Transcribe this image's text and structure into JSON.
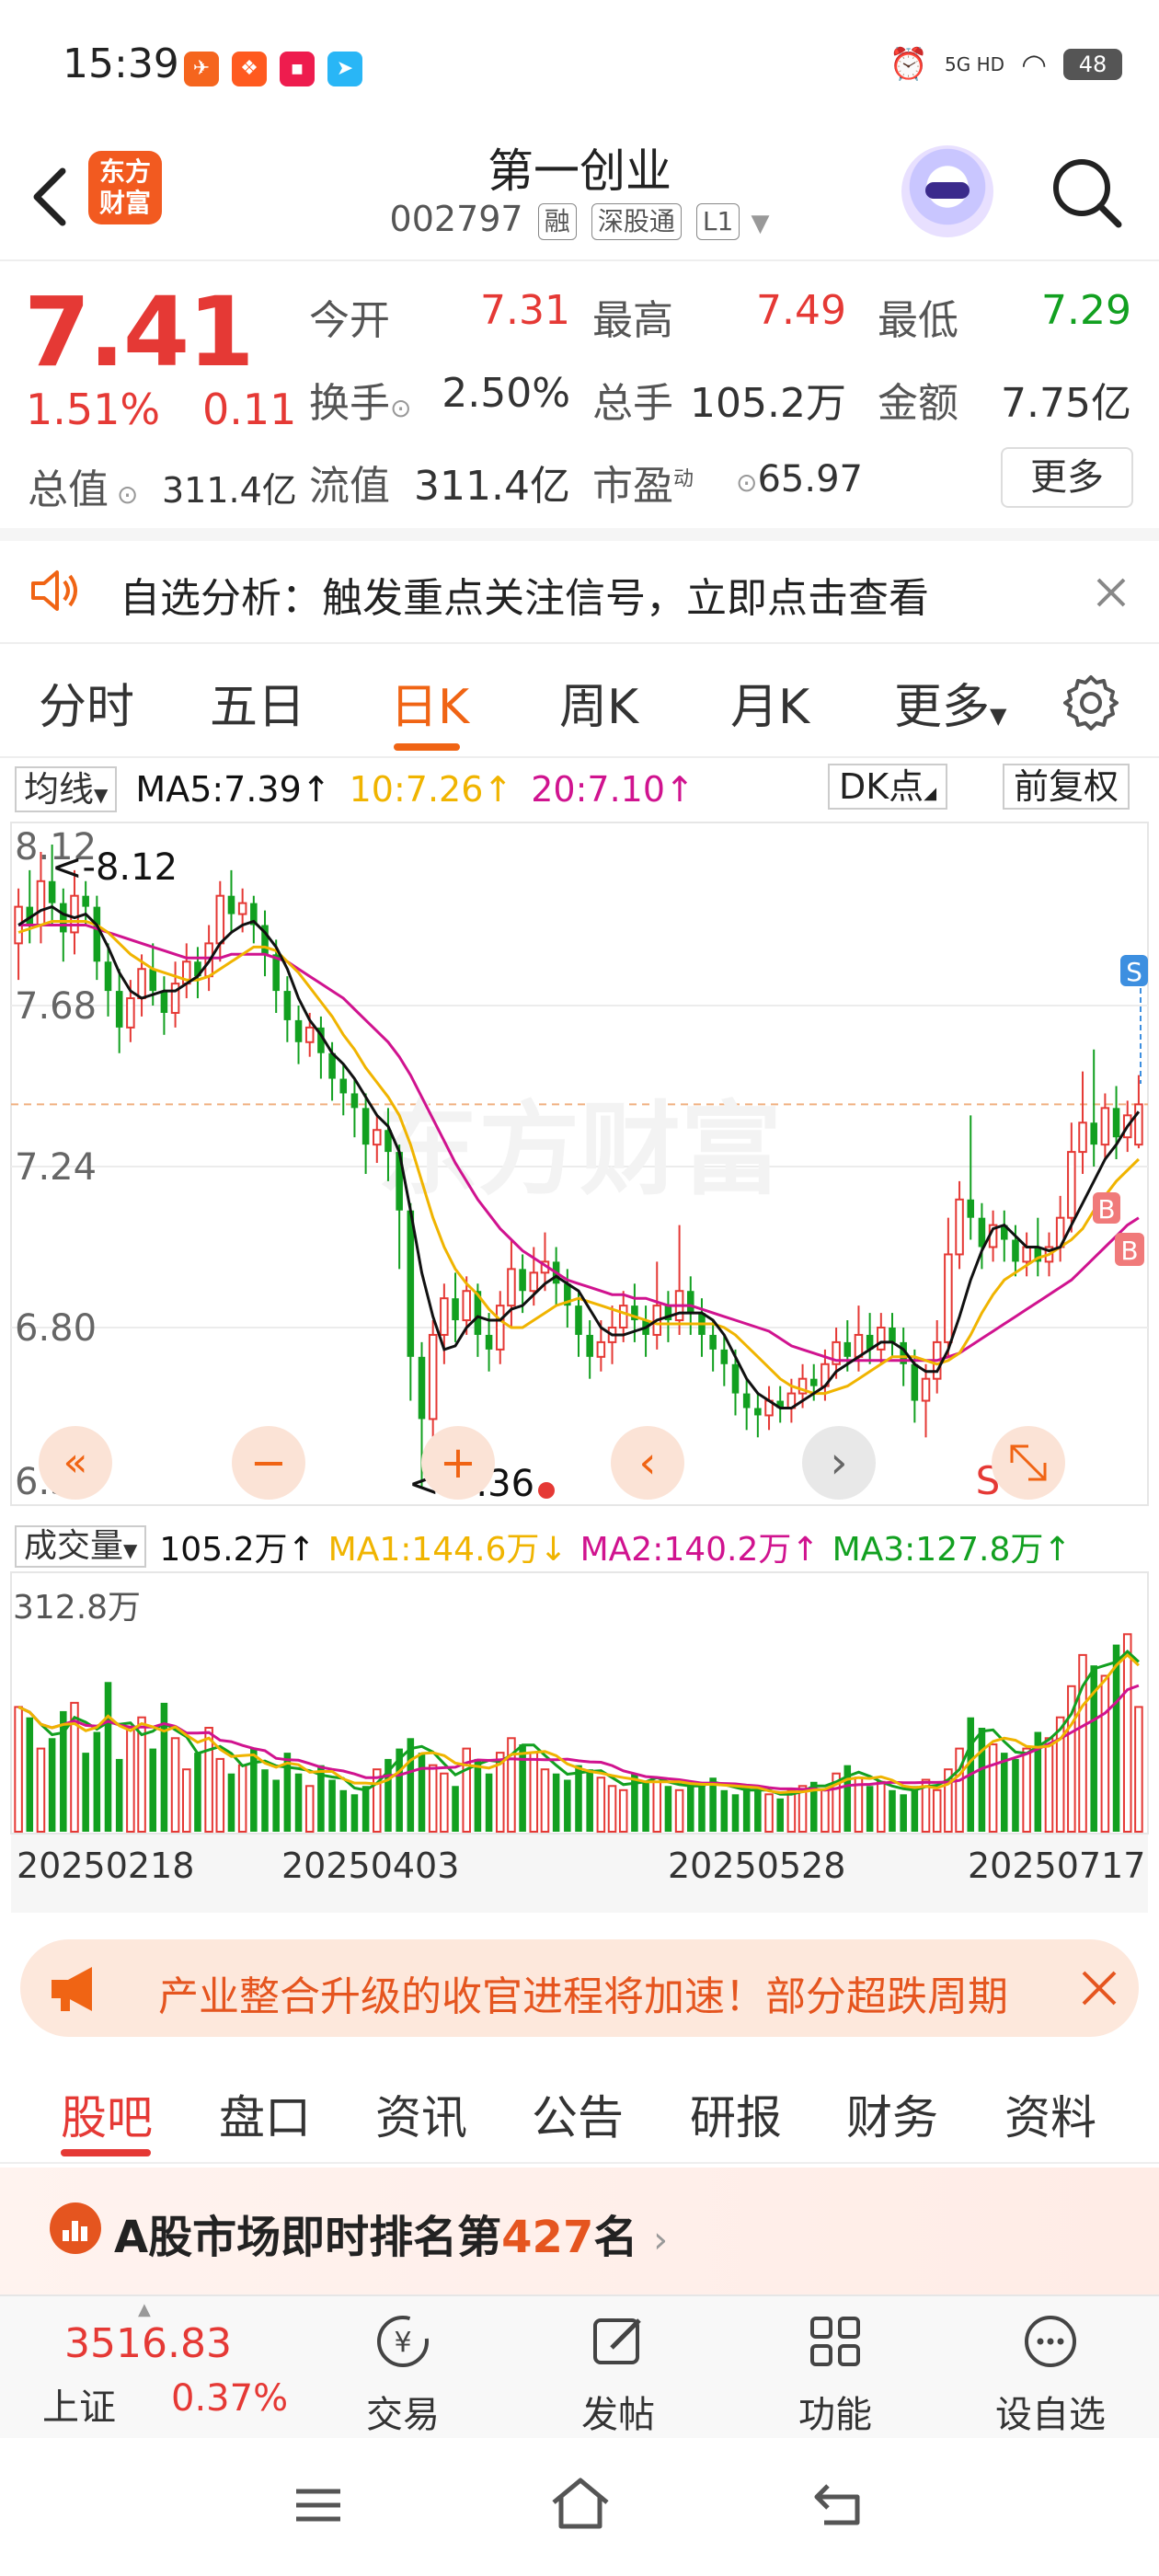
{
  "status_bar": {
    "time": "15:39",
    "network": "5G HD",
    "battery": "48",
    "notif_icons": [
      "app-icon-1",
      "app-icon-2",
      "app-icon-3",
      "app-icon-4"
    ]
  },
  "header": {
    "app_logo": "东方财富",
    "stock_name": "第一创业",
    "stock_code": "002797",
    "tags": [
      "融",
      "深股通",
      "L1"
    ]
  },
  "quote": {
    "price": "7.41",
    "change_pct": "1.51%",
    "change": "0.11",
    "total_value_label": "总值",
    "total_value": "311.4亿",
    "open_label": "今开",
    "open": "7.31",
    "high_label": "最高",
    "high": "7.49",
    "low_label": "最低",
    "low": "7.29",
    "turnover_label": "换手",
    "turnover": "2.50%",
    "volume_label": "总手",
    "volume": "105.2万",
    "amount_label": "金额",
    "amount": "7.75亿",
    "float_value_label": "流值",
    "float_value": "311.4亿",
    "pe_label": "市盈",
    "pe_sup": "动",
    "pe": "65.97",
    "more_button": "更多",
    "colors": {
      "up": "#e53935",
      "down": "#12a020"
    }
  },
  "alert": {
    "text": "自选分析：触发重点关注信号，立即点击查看"
  },
  "period_tabs": {
    "items": [
      "分时",
      "五日",
      "日K",
      "周K",
      "月K",
      "更多"
    ],
    "active": "日K"
  },
  "ma_row": {
    "selector": "均线",
    "ma5": "MA5:7.39",
    "ma10": "10:7.26",
    "ma20": "20:7.10",
    "dk_button": "DK点",
    "adjust_button": "前复权",
    "ma5_color": "#111111",
    "ma10_color": "#f0b400",
    "ma20_color": "#d0138f"
  },
  "chart_data": {
    "type": "candlestick",
    "y_ticks": [
      "8.12",
      "7.68",
      "7.24",
      "6.80",
      "6.36"
    ],
    "ylim": [
      6.36,
      8.12
    ],
    "high_marker": "<-8.12",
    "low_marker": "<-6.36",
    "signals": [
      "S",
      "B",
      "B"
    ],
    "candles": [
      [
        7.85,
        7.95,
        7.75,
        8.0
      ],
      [
        7.95,
        7.9,
        7.85,
        8.05
      ],
      [
        7.9,
        8.02,
        7.85,
        8.1
      ],
      [
        8.02,
        7.96,
        7.9,
        8.12
      ],
      [
        7.96,
        7.88,
        7.8,
        8.0
      ],
      [
        7.88,
        7.98,
        7.82,
        8.05
      ],
      [
        7.98,
        7.95,
        7.9,
        8.02
      ],
      [
        7.95,
        7.8,
        7.75,
        7.98
      ],
      [
        7.8,
        7.72,
        7.65,
        7.85
      ],
      [
        7.72,
        7.62,
        7.55,
        7.78
      ],
      [
        7.62,
        7.7,
        7.58,
        7.75
      ],
      [
        7.7,
        7.78,
        7.65,
        7.82
      ],
      [
        7.78,
        7.72,
        7.68,
        7.85
      ],
      [
        7.72,
        7.66,
        7.6,
        7.76
      ],
      [
        7.66,
        7.74,
        7.62,
        7.8
      ],
      [
        7.74,
        7.8,
        7.7,
        7.85
      ],
      [
        7.8,
        7.76,
        7.7,
        7.84
      ],
      [
        7.76,
        7.85,
        7.72,
        7.9
      ],
      [
        7.85,
        7.98,
        7.8,
        8.02
      ],
      [
        7.98,
        7.93,
        7.88,
        8.05
      ],
      [
        7.93,
        7.96,
        7.88,
        8.0
      ],
      [
        7.96,
        7.9,
        7.85,
        7.98
      ],
      [
        7.9,
        7.82,
        7.76,
        7.94
      ],
      [
        7.82,
        7.72,
        7.66,
        7.86
      ],
      [
        7.72,
        7.64,
        7.58,
        7.76
      ],
      [
        7.64,
        7.58,
        7.52,
        7.68
      ],
      [
        7.58,
        7.62,
        7.54,
        7.66
      ],
      [
        7.62,
        7.55,
        7.48,
        7.65
      ],
      [
        7.55,
        7.48,
        7.42,
        7.58
      ],
      [
        7.48,
        7.44,
        7.38,
        7.52
      ],
      [
        7.44,
        7.4,
        7.32,
        7.48
      ],
      [
        7.4,
        7.3,
        7.22,
        7.44
      ],
      [
        7.3,
        7.34,
        7.25,
        7.38
      ],
      [
        7.34,
        7.28,
        7.2,
        7.4
      ],
      [
        7.28,
        7.12,
        6.96,
        7.3
      ],
      [
        7.12,
        6.72,
        6.6,
        7.14
      ],
      [
        6.72,
        6.55,
        6.36,
        6.76
      ],
      [
        6.55,
        6.78,
        6.5,
        6.82
      ],
      [
        6.78,
        6.88,
        6.7,
        6.92
      ],
      [
        6.88,
        6.82,
        6.76,
        6.95
      ],
      [
        6.82,
        6.9,
        6.78,
        6.94
      ],
      [
        6.9,
        6.78,
        6.72,
        6.92
      ],
      [
        6.78,
        6.74,
        6.68,
        6.84
      ],
      [
        6.74,
        6.86,
        6.7,
        6.9
      ],
      [
        6.86,
        6.96,
        6.8,
        7.04
      ],
      [
        6.96,
        6.9,
        6.84,
        7.0
      ],
      [
        6.9,
        6.95,
        6.86,
        7.02
      ],
      [
        6.95,
        6.98,
        6.9,
        7.06
      ],
      [
        6.98,
        6.92,
        6.86,
        7.02
      ],
      [
        6.92,
        6.86,
        6.8,
        6.96
      ],
      [
        6.86,
        6.78,
        6.72,
        6.9
      ],
      [
        6.78,
        6.72,
        6.66,
        6.82
      ],
      [
        6.72,
        6.76,
        6.68,
        6.82
      ],
      [
        6.76,
        6.8,
        6.7,
        6.86
      ],
      [
        6.8,
        6.86,
        6.76,
        6.9
      ],
      [
        6.86,
        6.82,
        6.76,
        6.92
      ],
      [
        6.82,
        6.78,
        6.72,
        6.86
      ],
      [
        6.78,
        6.86,
        6.74,
        6.98
      ],
      [
        6.86,
        6.82,
        6.76,
        6.9
      ],
      [
        6.82,
        6.9,
        6.78,
        7.08
      ],
      [
        6.9,
        6.84,
        6.78,
        6.94
      ],
      [
        6.84,
        6.78,
        6.72,
        6.88
      ],
      [
        6.78,
        6.74,
        6.68,
        6.82
      ],
      [
        6.74,
        6.7,
        6.64,
        6.78
      ],
      [
        6.7,
        6.62,
        6.56,
        6.74
      ],
      [
        6.62,
        6.58,
        6.52,
        6.66
      ],
      [
        6.58,
        6.56,
        6.5,
        6.62
      ],
      [
        6.56,
        6.6,
        6.52,
        6.64
      ],
      [
        6.6,
        6.58,
        6.54,
        6.64
      ],
      [
        6.58,
        6.62,
        6.54,
        6.66
      ],
      [
        6.62,
        6.66,
        6.58,
        6.7
      ],
      [
        6.66,
        6.64,
        6.6,
        6.7
      ],
      [
        6.64,
        6.7,
        6.6,
        6.74
      ],
      [
        6.7,
        6.76,
        6.66,
        6.8
      ],
      [
        6.76,
        6.72,
        6.68,
        6.82
      ],
      [
        6.72,
        6.78,
        6.68,
        6.86
      ],
      [
        6.78,
        6.74,
        6.7,
        6.84
      ],
      [
        6.74,
        6.8,
        6.7,
        6.84
      ],
      [
        6.8,
        6.76,
        6.72,
        6.84
      ],
      [
        6.76,
        6.7,
        6.64,
        6.8
      ],
      [
        6.7,
        6.6,
        6.54,
        6.74
      ],
      [
        6.6,
        6.66,
        6.5,
        6.7
      ],
      [
        6.66,
        6.76,
        6.62,
        6.82
      ],
      [
        6.76,
        7.0,
        6.72,
        7.1
      ],
      [
        7.0,
        7.15,
        6.96,
        7.2
      ],
      [
        7.15,
        7.1,
        7.04,
        7.38
      ],
      [
        7.1,
        7.02,
        6.96,
        7.14
      ],
      [
        7.02,
        7.08,
        6.98,
        7.12
      ],
      [
        7.08,
        7.04,
        6.98,
        7.12
      ],
      [
        7.04,
        6.98,
        6.94,
        7.08
      ],
      [
        6.98,
        7.02,
        6.94,
        7.06
      ],
      [
        7.02,
        6.98,
        6.94,
        7.1
      ],
      [
        6.98,
        7.02,
        6.94,
        7.06
      ],
      [
        7.02,
        7.1,
        6.98,
        7.16
      ],
      [
        7.1,
        7.28,
        7.06,
        7.36
      ],
      [
        7.28,
        7.36,
        7.22,
        7.5
      ],
      [
        7.36,
        7.3,
        7.24,
        7.56
      ],
      [
        7.3,
        7.4,
        7.26,
        7.44
      ],
      [
        7.4,
        7.32,
        7.26,
        7.46
      ],
      [
        7.32,
        7.38,
        7.28,
        7.42
      ],
      [
        7.3,
        7.41,
        7.29,
        7.49
      ]
    ],
    "ma5": [
      7.9,
      7.92,
      7.94,
      7.95,
      7.93,
      7.92,
      7.93,
      7.9,
      7.84,
      7.77,
      7.72,
      7.7,
      7.71,
      7.72,
      7.72,
      7.74,
      7.76,
      7.8,
      7.85,
      7.88,
      7.9,
      7.91,
      7.88,
      7.84,
      7.78,
      7.7,
      7.64,
      7.6,
      7.55,
      7.52,
      7.48,
      7.43,
      7.38,
      7.35,
      7.28,
      7.12,
      6.95,
      6.83,
      6.74,
      6.75,
      6.8,
      6.83,
      6.82,
      6.82,
      6.85,
      6.86,
      6.89,
      6.92,
      6.94,
      6.92,
      6.9,
      6.85,
      6.8,
      6.78,
      6.78,
      6.79,
      6.8,
      6.82,
      6.83,
      6.84,
      6.84,
      6.84,
      6.82,
      6.78,
      6.72,
      6.66,
      6.62,
      6.6,
      6.58,
      6.58,
      6.6,
      6.62,
      6.64,
      6.68,
      6.7,
      6.72,
      6.74,
      6.76,
      6.76,
      6.74,
      6.7,
      6.68,
      6.68,
      6.74,
      6.83,
      6.93,
      7.01,
      7.07,
      7.08,
      7.05,
      7.02,
      7.02,
      7.01,
      7.02,
      7.08,
      7.14,
      7.2,
      7.26,
      7.3,
      7.35,
      7.39
    ],
    "ma10": [
      7.88,
      7.89,
      7.9,
      7.91,
      7.91,
      7.91,
      7.91,
      7.9,
      7.88,
      7.85,
      7.82,
      7.8,
      7.78,
      7.77,
      7.76,
      7.75,
      7.75,
      7.76,
      7.78,
      7.8,
      7.82,
      7.84,
      7.84,
      7.83,
      7.8,
      7.77,
      7.73,
      7.69,
      7.65,
      7.6,
      7.56,
      7.51,
      7.47,
      7.43,
      7.38,
      7.3,
      7.2,
      7.1,
      7.02,
      6.96,
      6.92,
      6.89,
      6.85,
      6.82,
      6.8,
      6.8,
      6.82,
      6.84,
      6.86,
      6.87,
      6.88,
      6.87,
      6.86,
      6.85,
      6.84,
      6.83,
      6.82,
      6.81,
      6.81,
      6.81,
      6.81,
      6.81,
      6.81,
      6.8,
      6.78,
      6.75,
      6.72,
      6.69,
      6.66,
      6.64,
      6.63,
      6.62,
      6.62,
      6.63,
      6.64,
      6.66,
      6.68,
      6.7,
      6.72,
      6.72,
      6.72,
      6.71,
      6.7,
      6.71,
      6.73,
      6.78,
      6.84,
      6.89,
      6.93,
      6.95,
      6.97,
      6.99,
      7.0,
      7.02,
      7.04,
      7.07,
      7.12,
      7.16,
      7.2,
      7.23,
      7.26
    ],
    "ma20": [
      7.9,
      7.9,
      7.9,
      7.9,
      7.9,
      7.9,
      7.9,
      7.89,
      7.88,
      7.87,
      7.86,
      7.85,
      7.84,
      7.83,
      7.82,
      7.81,
      7.81,
      7.81,
      7.81,
      7.82,
      7.82,
      7.82,
      7.82,
      7.81,
      7.8,
      7.78,
      7.76,
      7.74,
      7.72,
      7.7,
      7.67,
      7.64,
      7.61,
      7.58,
      7.54,
      7.49,
      7.43,
      7.37,
      7.31,
      7.25,
      7.2,
      7.15,
      7.11,
      7.07,
      7.04,
      7.01,
      6.99,
      6.97,
      6.95,
      6.93,
      6.92,
      6.91,
      6.9,
      6.89,
      6.89,
      6.88,
      6.88,
      6.87,
      6.86,
      6.86,
      6.86,
      6.85,
      6.84,
      6.83,
      6.82,
      6.81,
      6.8,
      6.79,
      6.77,
      6.75,
      6.74,
      6.73,
      6.72,
      6.71,
      6.71,
      6.71,
      6.71,
      6.71,
      6.71,
      6.71,
      6.71,
      6.71,
      6.71,
      6.72,
      6.73,
      6.75,
      6.77,
      6.79,
      6.81,
      6.83,
      6.85,
      6.87,
      6.89,
      6.91,
      6.93,
      6.96,
      6.99,
      7.02,
      7.05,
      7.08,
      7.1
    ]
  },
  "chart_controls": [
    "«",
    "−",
    "+",
    "‹",
    "›",
    "S",
    "expand-icon"
  ],
  "volume": {
    "selector": "成交量",
    "value": "105.2万",
    "ma1": "MA1:144.6万",
    "ma2": "MA2:140.2万",
    "ma3": "MA3:127.8万",
    "max_label": "312.8万",
    "ma1_color": "#f0b400",
    "ma2_color": "#d0138f",
    "ma3_color": "#12a020",
    "dates": [
      "20250218",
      "20250403",
      "20250528",
      "20250717"
    ],
    "bars": [
      60,
      55,
      40,
      45,
      58,
      62,
      38,
      48,
      72,
      35,
      50,
      55,
      40,
      62,
      45,
      30,
      38,
      50,
      35,
      28,
      32,
      40,
      30,
      25,
      38,
      28,
      22,
      32,
      25,
      20,
      18,
      22,
      30,
      35,
      40,
      45,
      38,
      32,
      28,
      22,
      40,
      35,
      28,
      38,
      45,
      42,
      38,
      30,
      28,
      25,
      32,
      30,
      26,
      22,
      20,
      28,
      24,
      26,
      22,
      20,
      24,
      22,
      26,
      20,
      18,
      22,
      20,
      18,
      16,
      20,
      22,
      24,
      20,
      28,
      32,
      26,
      22,
      24,
      20,
      18,
      22,
      25,
      20,
      30,
      40,
      55,
      50,
      42,
      38,
      35,
      40,
      48,
      45,
      55,
      70,
      85,
      80,
      75,
      90,
      95,
      60
    ]
  },
  "promo": {
    "text": "产业整合升级的收官进程将加速！部分超跌周期"
  },
  "content_tabs": {
    "items": [
      "股吧",
      "盘口",
      "资讯",
      "公告",
      "研报",
      "财务",
      "资料"
    ],
    "active": "股吧"
  },
  "rank": {
    "prefix": "A股市场即时排名第",
    "number": "427",
    "suffix": "名"
  },
  "bottom_bar": {
    "index_value": "3516.83",
    "index_name": "上证",
    "index_pct": "0.37%",
    "items": [
      "交易",
      "发帖",
      "功能",
      "设自选"
    ]
  }
}
